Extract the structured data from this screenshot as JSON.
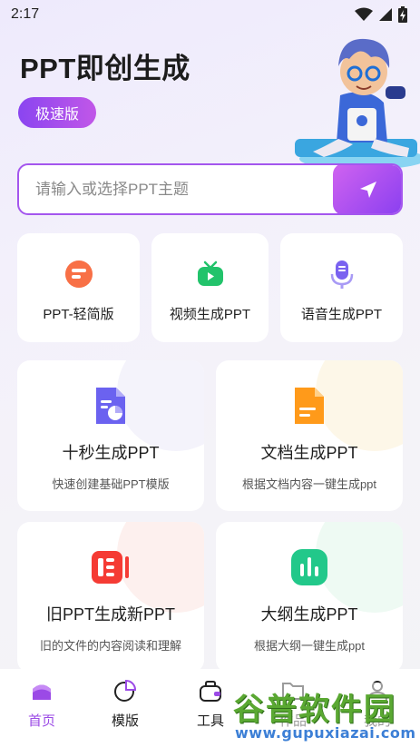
{
  "status_bar": {
    "time": "2:17",
    "icons": [
      "wifi-icon",
      "signal-icon",
      "battery-charging-icon"
    ]
  },
  "hero": {
    "title": "PPT即创生成",
    "badge": "极速版"
  },
  "search": {
    "placeholder": "请输入或选择PPT主题",
    "value": ""
  },
  "quick_tools": [
    {
      "label": "PPT-轻简版",
      "icon": "ppt-lite-icon",
      "color": "#f45a3c"
    },
    {
      "label": "视频生成PPT",
      "icon": "video-tv-icon",
      "color": "#22c36b"
    },
    {
      "label": "语音生成PPT",
      "icon": "microphone-icon",
      "color": "#7a62f0"
    }
  ],
  "features": [
    {
      "title": "十秒生成PPT",
      "subtitle": "快速创建基础PPT模版",
      "icon": "document-chart-icon",
      "color": "#6b62f0"
    },
    {
      "title": "文档生成PPT",
      "subtitle": "根据文档内容一键生成ppt",
      "icon": "document-icon",
      "color": "#ff9a1a"
    },
    {
      "title": "旧PPT生成新PPT",
      "subtitle": "旧的文件的内容阅读和理解",
      "icon": "ppt-convert-icon",
      "color": "#f53b34"
    },
    {
      "title": "大纲生成PPT",
      "subtitle": "根据大纲一键生成ppt",
      "icon": "bar-chart-icon",
      "color": "#22c88a"
    }
  ],
  "bottom_nav": [
    {
      "label": "首页",
      "icon": "home-icon",
      "active": true
    },
    {
      "label": "模版",
      "icon": "template-icon",
      "active": false
    },
    {
      "label": "工具",
      "icon": "toolbox-icon",
      "active": false
    },
    {
      "label": "作品",
      "icon": "folder-icon",
      "active": false
    },
    {
      "label": "我的",
      "icon": "user-icon",
      "active": false
    }
  ],
  "watermark": {
    "title": "谷普软件园",
    "url": "www.gupuxiazai.com"
  },
  "colors": {
    "accent": "#a456ee",
    "nav_active": "#9b4ae6"
  }
}
